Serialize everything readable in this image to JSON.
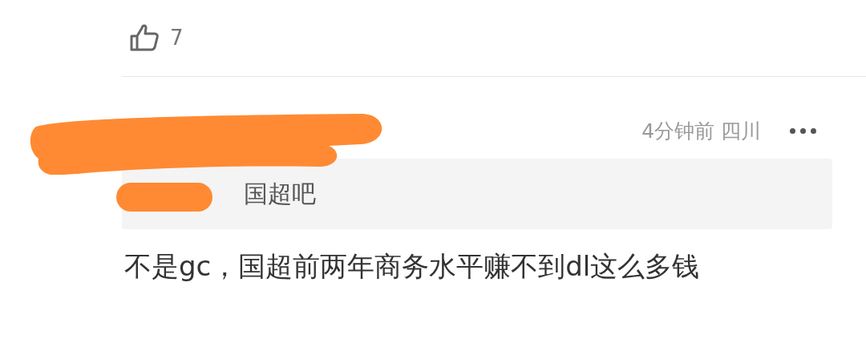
{
  "like": {
    "count": "7"
  },
  "comment": {
    "time": "4分钟前",
    "location": "四川",
    "quote": {
      "forum": "国超吧"
    },
    "text": "不是gc，国超前两年商务水平赚不到dl这么多钱"
  }
}
